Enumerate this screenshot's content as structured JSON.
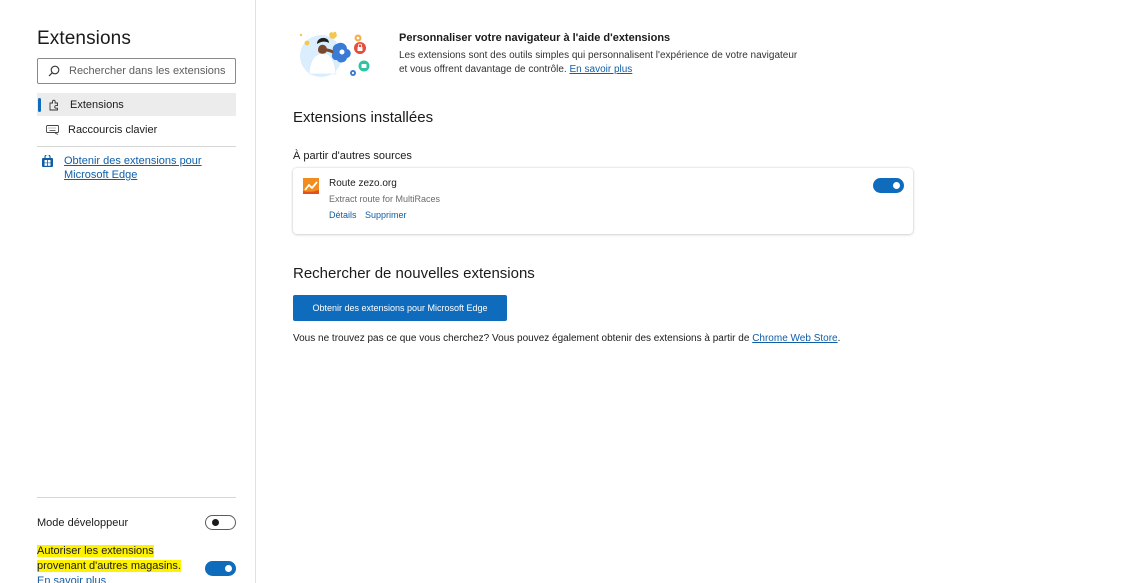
{
  "sidebar": {
    "title": "Extensions",
    "search_placeholder": "Rechercher dans les extensions in...",
    "items": [
      {
        "label": "Extensions"
      },
      {
        "label": "Raccourcis clavier"
      }
    ],
    "get_extensions_link": "Obtenir des extensions pour Microsoft Edge",
    "developer_mode_label": "Mode développeur",
    "developer_mode_on": false,
    "other_stores_text": "Autoriser les extensions provenant d'autres magasins.",
    "other_stores_link": "En savoir plus",
    "other_stores_on": true
  },
  "main": {
    "hero_title": "Personnaliser votre navigateur à l'aide d'extensions",
    "hero_desc": "Les extensions sont des outils simples qui personnalisent l'expérience de votre navigateur et vous offrent davantage de contrôle.",
    "hero_link": "En savoir plus",
    "installed_heading": "Extensions installées",
    "sources_label": "À partir d'autres sources",
    "extension": {
      "name": "Route zezo.org",
      "description": "Extract route for MultiRaces",
      "details_link": "Détails",
      "remove_link": "Supprimer",
      "enabled": true
    },
    "find_heading": "Rechercher de nouvelles extensions",
    "get_button": "Obtenir des extensions pour Microsoft Edge",
    "find_text": "Vous ne trouvez pas ce que vous cherchez? Vous pouvez également obtenir des extensions à partir de",
    "find_link": "Chrome Web Store",
    "find_suffix": "."
  },
  "colors": {
    "accent": "#0f6cbd",
    "link": "#0f5ea8",
    "highlight": "#fff200"
  },
  "icons": [
    "search-icon",
    "extensions-icon",
    "keyboard-icon",
    "store-icon",
    "route-zezo-icon"
  ]
}
